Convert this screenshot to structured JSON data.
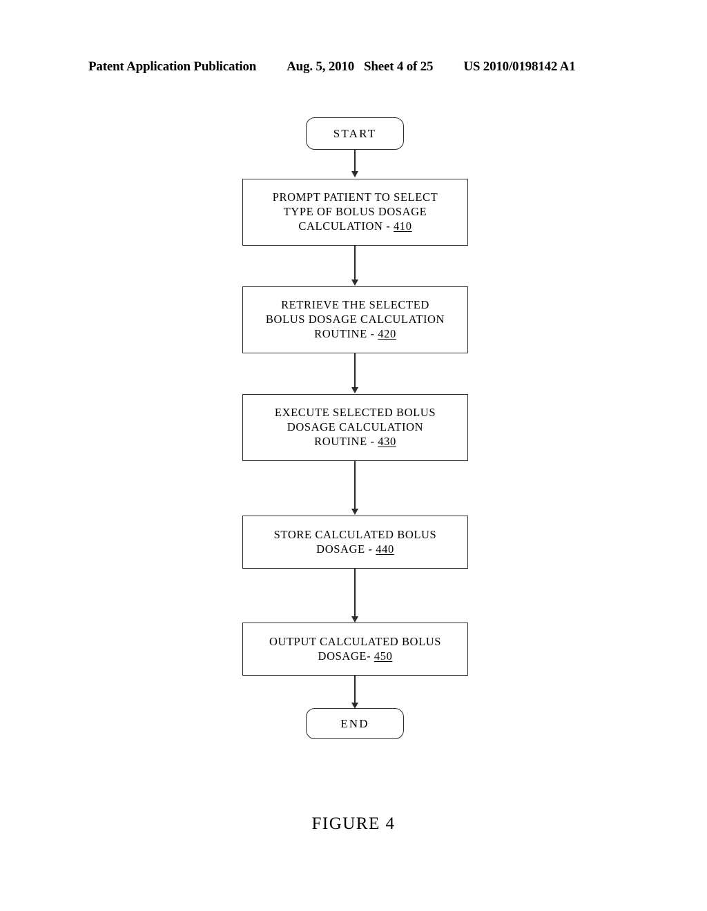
{
  "header": {
    "publication": "Patent Application Publication",
    "date": "Aug. 5, 2010",
    "sheet": "Sheet 4 of 25",
    "patent_number": "US 2010/0198142 A1"
  },
  "figure": {
    "caption": "FIGURE 4"
  },
  "diagram": {
    "type": "flowchart",
    "orientation": "vertical",
    "nodes": [
      {
        "id": "start",
        "shape": "terminator",
        "label": "START",
        "lines": [
          "START"
        ]
      },
      {
        "id": "step-410",
        "shape": "process",
        "ref": "410",
        "label": "PROMPT PATIENT TO SELECT TYPE OF BOLUS DOSAGE CALCULATION - 410",
        "lines": [
          "PROMPT PATIENT TO SELECT",
          "TYPE OF BOLUS DOSAGE",
          "CALCULATION - "
        ]
      },
      {
        "id": "step-420",
        "shape": "process",
        "ref": "420",
        "label": "RETRIEVE THE SELECTED BOLUS DOSAGE CALCULATION ROUTINE - 420",
        "lines": [
          "RETRIEVE THE SELECTED",
          "BOLUS DOSAGE CALCULATION",
          "ROUTINE - "
        ]
      },
      {
        "id": "step-430",
        "shape": "process",
        "ref": "430",
        "label": "EXECUTE SELECTED BOLUS DOSAGE CALCULATION ROUTINE - 430",
        "lines": [
          "EXECUTE SELECTED BOLUS",
          "DOSAGE CALCULATION",
          "ROUTINE - "
        ]
      },
      {
        "id": "step-440",
        "shape": "process",
        "ref": "440",
        "label": "STORE CALCULATED BOLUS DOSAGE - 440",
        "lines": [
          "STORE CALCULATED BOLUS",
          "DOSAGE - "
        ]
      },
      {
        "id": "step-450",
        "shape": "process",
        "ref": "450",
        "label": "OUTPUT CALCULATED BOLUS DOSAGE- 450",
        "lines": [
          "OUTPUT CALCULATED BOLUS",
          "DOSAGE- "
        ]
      },
      {
        "id": "end",
        "shape": "terminator",
        "label": "END",
        "lines": [
          "END"
        ]
      }
    ],
    "edges": [
      {
        "from": "start",
        "to": "step-410",
        "arrow": "down"
      },
      {
        "from": "step-410",
        "to": "step-420",
        "arrow": "down"
      },
      {
        "from": "step-420",
        "to": "step-430",
        "arrow": "down"
      },
      {
        "from": "step-430",
        "to": "step-440",
        "arrow": "down"
      },
      {
        "from": "step-440",
        "to": "step-450",
        "arrow": "down"
      },
      {
        "from": "step-450",
        "to": "end",
        "arrow": "down"
      }
    ]
  },
  "colors": {
    "ink": "#2b2b2b",
    "text": "#000000",
    "page": "#ffffff"
  }
}
